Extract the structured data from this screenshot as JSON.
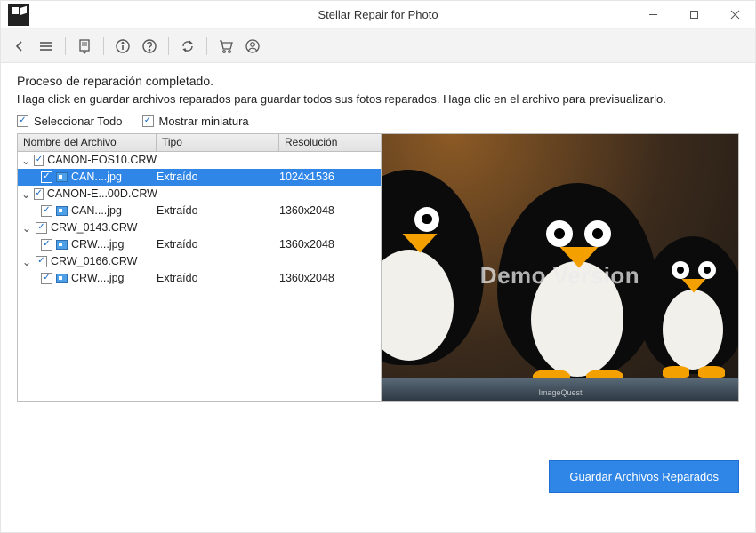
{
  "window": {
    "title": "Stellar Repair for Photo"
  },
  "checkboxes": {
    "select_all_label": "Seleccionar Todo",
    "show_thumb_label": "Mostrar miniatura"
  },
  "messages": {
    "heading": "Proceso de reparación completado.",
    "sub": "Haga click en guardar archivos reparados para guardar todos sus fotos reparados. Haga clic en el archivo para previsualizarlo."
  },
  "columns": {
    "name": "Nombre del Archivo",
    "type": "Tipo",
    "res": "Resolución"
  },
  "tree": {
    "g0": {
      "name": "CANON-EOS10.CRW",
      "child": {
        "name": "CAN....jpg",
        "type": "Extraído",
        "res": "1024x1536"
      }
    },
    "g1": {
      "name": "CANON-E...00D.CRW",
      "child": {
        "name": "CAN....jpg",
        "type": "Extraído",
        "res": "1360x2048"
      }
    },
    "g2": {
      "name": "CRW_0143.CRW",
      "child": {
        "name": "CRW....jpg",
        "type": "Extraído",
        "res": "1360x2048"
      }
    },
    "g3": {
      "name": "CRW_0166.CRW",
      "child": {
        "name": "CRW....jpg",
        "type": "Extraído",
        "res": "1360x2048"
      }
    }
  },
  "preview": {
    "watermark": "Demo Version",
    "shelf_label": "ImageQuest"
  },
  "buttons": {
    "save": "Guardar Archivos Reparados"
  }
}
